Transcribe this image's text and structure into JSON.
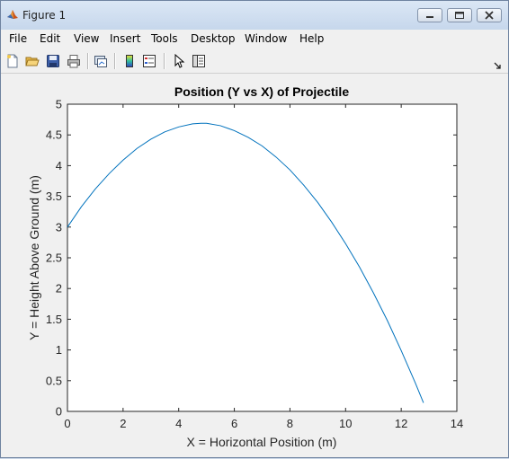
{
  "window": {
    "title": "Figure 1"
  },
  "menu": [
    {
      "label": "File",
      "name": "menu-file"
    },
    {
      "label": "Edit",
      "name": "menu-edit"
    },
    {
      "label": "View",
      "name": "menu-view"
    },
    {
      "label": "Insert",
      "name": "menu-insert"
    },
    {
      "label": "Tools",
      "name": "menu-tools"
    },
    {
      "label": "Desktop",
      "name": "menu-desktop"
    },
    {
      "label": "Window",
      "name": "menu-window"
    },
    {
      "label": "Help",
      "name": "menu-help"
    }
  ],
  "toolbar": [
    {
      "icon": "new-figure-icon"
    },
    {
      "icon": "open-file-icon"
    },
    {
      "icon": "save-icon"
    },
    {
      "icon": "print-icon"
    },
    {
      "icon": "link-plot-icon"
    },
    {
      "icon": "insert-colorbar-icon"
    },
    {
      "icon": "insert-legend-icon"
    },
    {
      "icon": "edit-plot-arrow-icon"
    },
    {
      "icon": "show-plot-tools-icon"
    }
  ],
  "chart_data": {
    "type": "line",
    "title": "Position (Y vs X) of Projectile",
    "xlabel": "X = Horizontal Position (m)",
    "ylabel": "Y = Height Above Ground (m)",
    "xlim": [
      0,
      14
    ],
    "ylim": [
      0,
      5
    ],
    "xticks": [
      "0",
      "2",
      "4",
      "6",
      "8",
      "10",
      "12",
      "14"
    ],
    "yticks": [
      "0",
      "0.5",
      "1",
      "1.5",
      "2",
      "2.5",
      "3",
      "3.5",
      "4",
      "4.5",
      "5"
    ],
    "grid": false,
    "color": "#0072bd",
    "series": [
      {
        "x": [
          0,
          0.5,
          1,
          1.5,
          2,
          2.5,
          3,
          3.5,
          4,
          4.5,
          4.8,
          5,
          5.5,
          6,
          6.5,
          7,
          7.5,
          8,
          8.5,
          9,
          9.5,
          10,
          10.5,
          11,
          11.5,
          12,
          12.5,
          12.8
        ],
        "y": [
          3.0,
          3.33,
          3.62,
          3.87,
          4.09,
          4.28,
          4.43,
          4.55,
          4.63,
          4.68,
          4.69,
          4.69,
          4.65,
          4.57,
          4.46,
          4.32,
          4.14,
          3.93,
          3.68,
          3.4,
          3.08,
          2.73,
          2.35,
          1.93,
          1.48,
          0.99,
          0.47,
          0.14
        ]
      }
    ]
  }
}
